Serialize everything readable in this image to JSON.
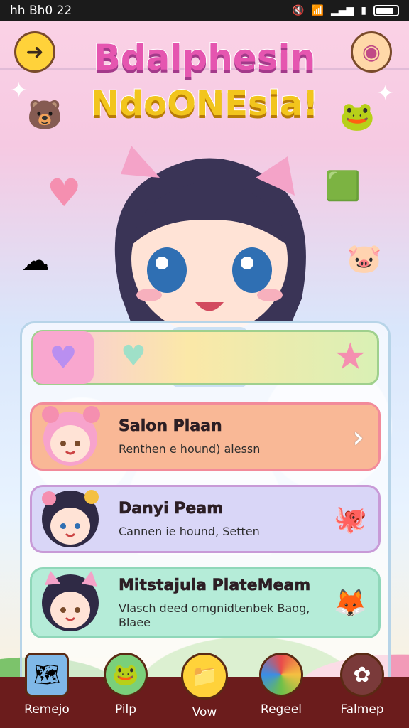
{
  "status_bar": {
    "time": "hh Bh0 22"
  },
  "header": {
    "back_icon": "arrow-left-icon",
    "camera_icon": "camera-icon",
    "title_line1": "Bdalphesin",
    "title_line2": "NdoONEsia!"
  },
  "cards": [
    {
      "title": "Salon Plaan",
      "subtitle": "Renthen e hound) alessn",
      "accent": "#f9b896"
    },
    {
      "title": "Danyi Peam",
      "subtitle": "Cannen ie hound, Setten",
      "accent": "#d9d6f7"
    },
    {
      "title": "Mitstajula PlateMeam",
      "subtitle": "Vlasch deed omgnidtenbek Baog, Blaee",
      "accent": "#b5ecd8"
    }
  ],
  "nav": [
    {
      "label": "Remejo",
      "icon": "map-icon"
    },
    {
      "label": "Pilp",
      "icon": "frog-icon"
    },
    {
      "label": "Vow",
      "icon": "folder-icon"
    },
    {
      "label": "Regeel",
      "icon": "paint-ball-icon"
    },
    {
      "label": "Falmep",
      "icon": "bone-icon"
    }
  ],
  "colors": {
    "title_pink": "#e556b0",
    "title_yellow": "#f2c51d",
    "nav_bg": "#6b1c1c"
  }
}
